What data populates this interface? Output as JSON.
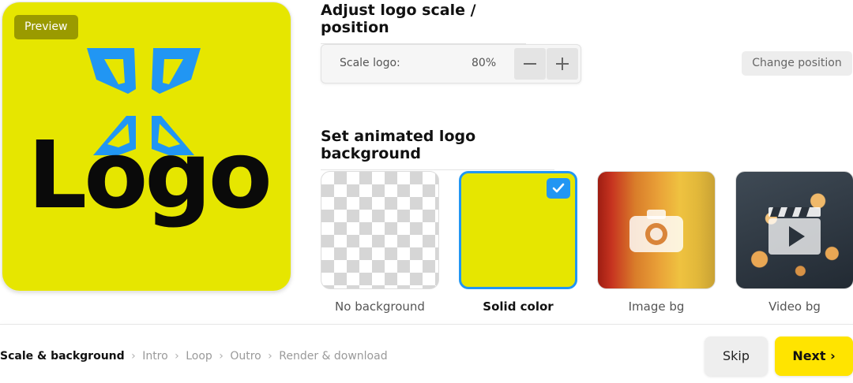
{
  "preview": {
    "badge": "Preview",
    "logo_text": "Logo",
    "background_color": "#e6e600",
    "logo_mark_color": "#2196f3"
  },
  "scale_section": {
    "title": "Adjust logo scale / position",
    "scale_label": "Scale logo:",
    "scale_value": "80%",
    "minus_icon": "minus-icon",
    "plus_icon": "plus-icon",
    "change_position_label": "Change position"
  },
  "background_section": {
    "title": "Set animated logo background",
    "options": [
      {
        "label": "No background",
        "selected": false
      },
      {
        "label": "Solid color",
        "selected": true
      },
      {
        "label": "Image bg",
        "selected": false
      },
      {
        "label": "Video bg",
        "selected": false
      }
    ],
    "selected_accent": "#2196f3"
  },
  "footer": {
    "breadcrumb": [
      "Scale & background",
      "Intro",
      "Loop",
      "Outro",
      "Render & download"
    ],
    "separator": "›",
    "skip_label": "Skip",
    "next_label": "Next ›",
    "next_color": "#ffe400"
  }
}
